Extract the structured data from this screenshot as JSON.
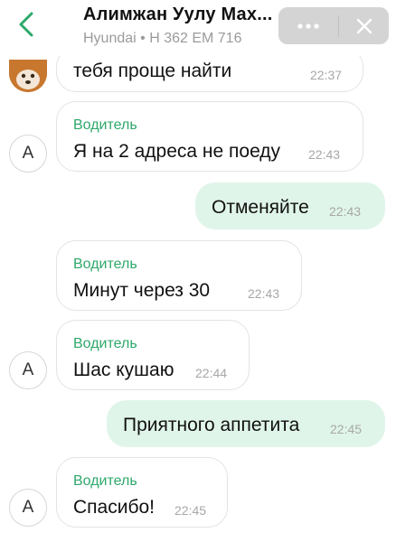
{
  "header": {
    "title": "Алимжан Уулу Мах...",
    "subtitle": "Hyundai • Н 362 ЕМ 716",
    "back_icon": "chevron-left-icon",
    "more_icon": "more-horizontal-icon",
    "close_icon": "close-icon"
  },
  "colors": {
    "accent": "#2ea86a",
    "outgoing_bubble": "#e0f5e9",
    "header_pill": "#d4d4d4"
  },
  "messages": [
    {
      "direction": "incoming",
      "sender": "",
      "text": "тебя проще найти",
      "time": "22:37",
      "avatar": "photo"
    },
    {
      "direction": "incoming",
      "sender": "Водитель",
      "text": "Я на 2 адреса не поеду",
      "time": "22:43",
      "avatar": "А"
    },
    {
      "direction": "outgoing",
      "text": "Отменяйте",
      "time": "22:43"
    },
    {
      "direction": "incoming",
      "sender": "Водитель",
      "text": "Минут  через  30",
      "time": "22:43",
      "avatar": ""
    },
    {
      "direction": "incoming",
      "sender": "Водитель",
      "text": "Шас кушаю",
      "time": "22:44",
      "avatar": "А"
    },
    {
      "direction": "outgoing",
      "text": "Приятного аппетита",
      "time": "22:45"
    },
    {
      "direction": "incoming",
      "sender": "Водитель",
      "text": "Спасибо!",
      "time": "22:45",
      "avatar": "А"
    }
  ]
}
